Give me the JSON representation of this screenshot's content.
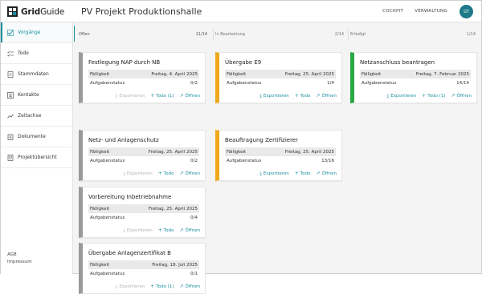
{
  "app": {
    "name_bold": "Grid",
    "name_rest": "Guide"
  },
  "page_title": "PV Projekt Produktionshalle",
  "topnav": {
    "cockpit": "COCKPIT",
    "verwaltung": "VERWALTUNG",
    "avatar": "GT"
  },
  "sidebar": {
    "items": [
      {
        "label": "Vorgänge",
        "icon": "tasks-icon"
      },
      {
        "label": "Todo",
        "icon": "checklist-icon"
      },
      {
        "label": "Stammdaten",
        "icon": "document-icon"
      },
      {
        "label": "Kontakte",
        "icon": "contacts-icon"
      },
      {
        "label": "Zeitachse",
        "icon": "timeline-icon"
      },
      {
        "label": "Dokumente",
        "icon": "folder-icon"
      },
      {
        "label": "Projektübersicht",
        "icon": "overview-icon"
      }
    ],
    "footer": [
      "AGB",
      "Impressum"
    ]
  },
  "columns": [
    {
      "label": "Offen",
      "count": "11/14"
    },
    {
      "label": "In Bearbeitung",
      "count": "2/14"
    },
    {
      "label": "Erledigt",
      "count": "1/14"
    }
  ],
  "field_labels": {
    "due": "Fälligkeit",
    "status": "Aufgabenstatus"
  },
  "action_labels": {
    "export": "Exportieren",
    "todo": "Todo",
    "open": "Öffnen"
  },
  "cards": [
    {
      "title": "Festlegung NAP durch NB",
      "due": "Freitag, 4. April 2025",
      "status": "0/2",
      "todo": "Todo (1)"
    },
    {
      "title": "Netz- und Anlagenschutz",
      "due": "Freitag, 25. April 2025",
      "status": "0/2",
      "todo": "Todo"
    },
    {
      "title": "Vorbereitung Inbetriebnahme",
      "due": "Freitag, 25. April 2025",
      "status": "0/4",
      "todo": "Todo"
    },
    {
      "title": "Übergabe Anlagenzertifikat B",
      "due": "Freitag, 18. Juli 2025",
      "status": "0/1",
      "todo": "Todo (1)"
    },
    {
      "title": "Übergabe E9",
      "due": "Freitag, 25. April 2025",
      "status": "1/4",
      "todo": "Todo"
    },
    {
      "title": "Beauftragung Zertifizierer",
      "due": "Freitag, 25. April 2025",
      "status": "13/16",
      "todo": "Todo"
    },
    {
      "title": "Netzanschluss beantragen",
      "due": "Freitag, 7. Februar 2025",
      "status": "14/14",
      "todo": "Todo (1)"
    }
  ],
  "colors": {
    "accent": "#1a8f9e",
    "gray_stripe": "#9a9a9a",
    "orange_stripe": "#f0a81c",
    "green_stripe": "#2aa844"
  }
}
